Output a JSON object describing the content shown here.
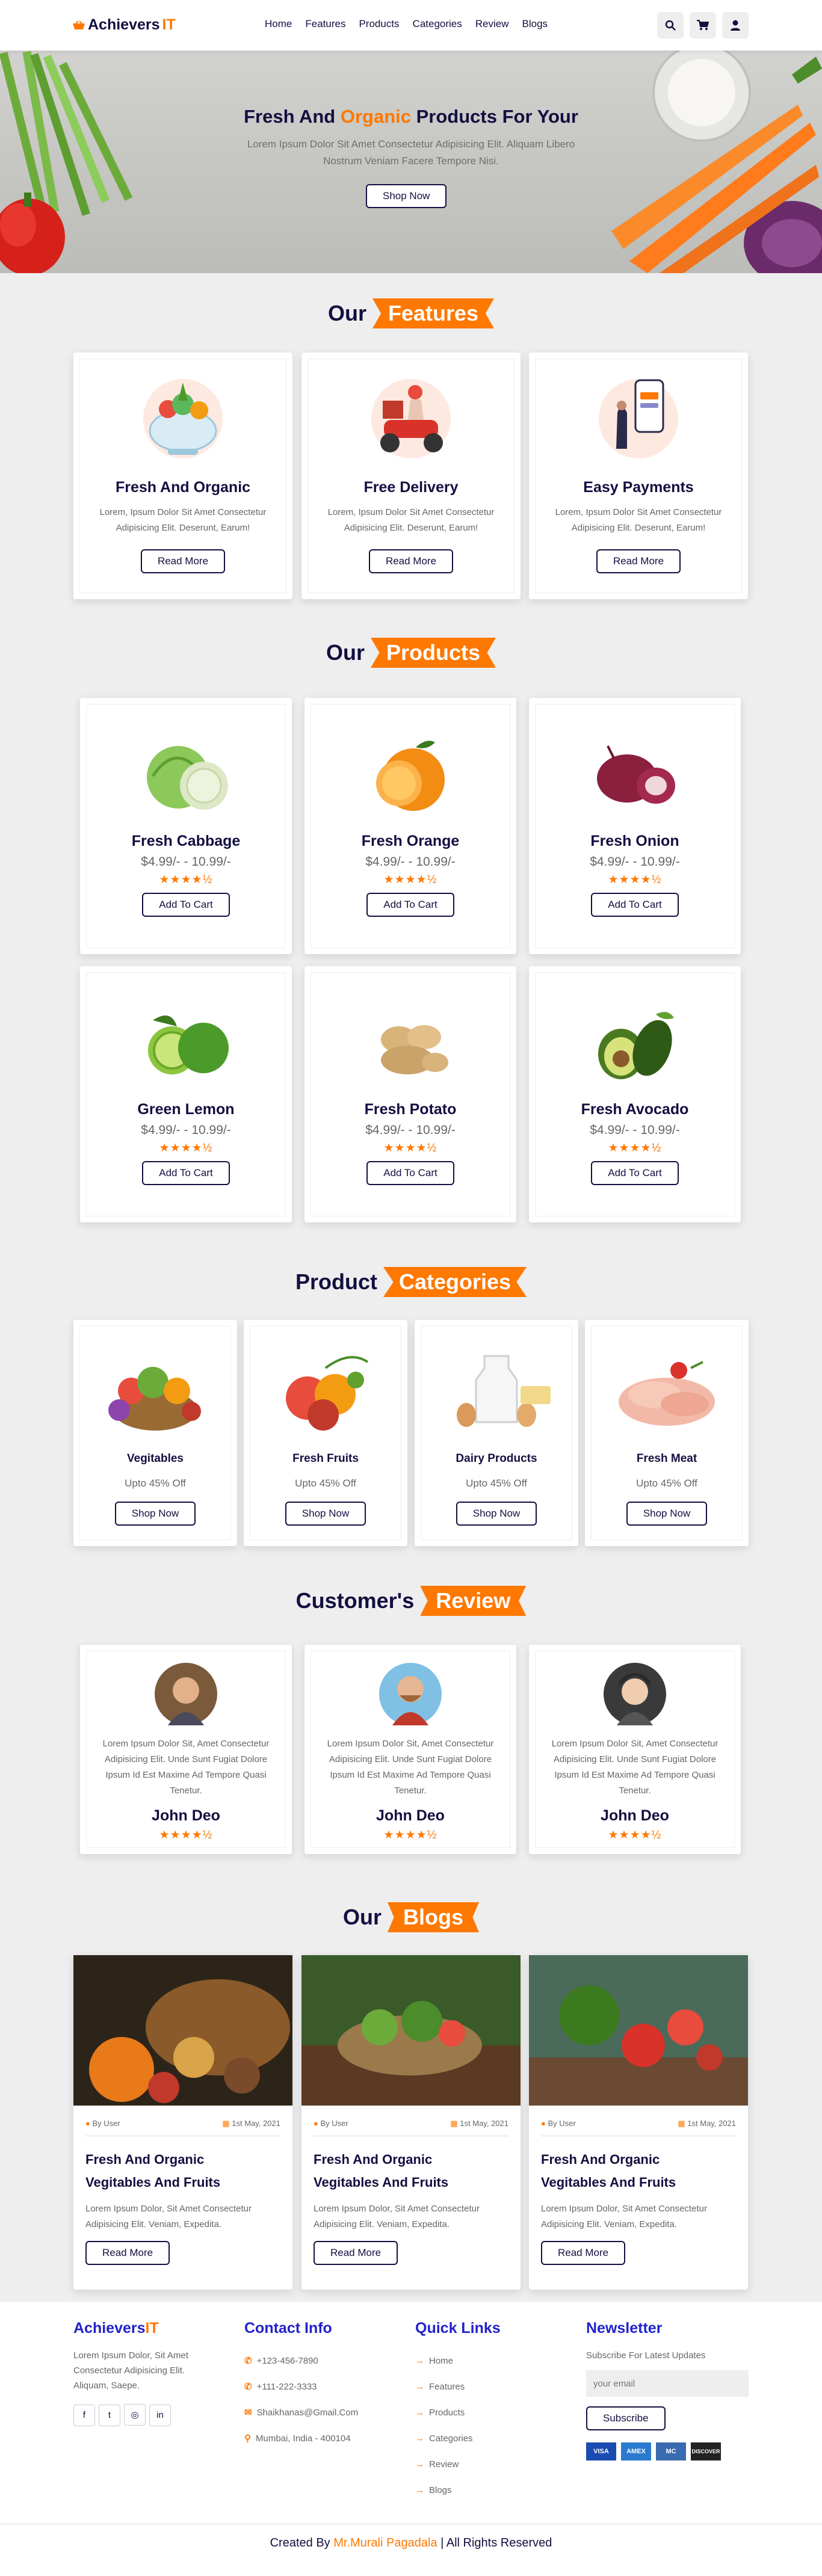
{
  "brand": {
    "name": "Achievers",
    "suffix": "IT"
  },
  "nav": [
    "Home",
    "Features",
    "Products",
    "Categories",
    "Review",
    "Blogs"
  ],
  "icons": [
    "search-icon",
    "cart-icon",
    "user-icon"
  ],
  "hero": {
    "title_pre": "Fresh And ",
    "title_accent": "Organic",
    "title_post": " Products For Your",
    "text": "Lorem Ipsum Dolor Sit Amet Consectetur Adipisicing Elit. Aliquam Libero Nostrum Veniam Facere Tempore Nisi.",
    "button": "Shop Now"
  },
  "features": {
    "heading": "Our",
    "ribbon": "Features",
    "items": [
      {
        "title": "Fresh And Organic",
        "text": "Lorem, Ipsum Dolor Sit Amet Consectetur Adipisicing Elit. Deserunt, Earum!",
        "button": "Read More"
      },
      {
        "title": "Free Delivery",
        "text": "Lorem, Ipsum Dolor Sit Amet Consectetur Adipisicing Elit. Deserunt, Earum!",
        "button": "Read More"
      },
      {
        "title": "Easy Payments",
        "text": "Lorem, Ipsum Dolor Sit Amet Consectetur Adipisicing Elit. Deserunt, Earum!",
        "button": "Read More"
      }
    ]
  },
  "products": {
    "heading": "Our",
    "ribbon": "Products",
    "items": [
      {
        "name": "Fresh Cabbage",
        "price": "$4.99/- - 10.99/-",
        "stars": "★★★★½",
        "button": "Add To Cart"
      },
      {
        "name": "Fresh Orange",
        "price": "$4.99/- - 10.99/-",
        "stars": "★★★★½",
        "button": "Add To Cart"
      },
      {
        "name": "Fresh Onion",
        "price": "$4.99/- - 10.99/-",
        "stars": "★★★★½",
        "button": "Add To Cart"
      },
      {
        "name": "Green Lemon",
        "price": "$4.99/- - 10.99/-",
        "stars": "★★★★½",
        "button": "Add To Cart"
      },
      {
        "name": "Fresh Potato",
        "price": "$4.99/- - 10.99/-",
        "stars": "★★★★½",
        "button": "Add To Cart"
      },
      {
        "name": "Fresh Avocado",
        "price": "$4.99/- - 10.99/-",
        "stars": "★★★★½",
        "button": "Add To Cart"
      }
    ]
  },
  "categories": {
    "heading": "Product",
    "ribbon": "Categories",
    "items": [
      {
        "name": "Vegitables",
        "offer": "Upto 45% Off",
        "button": "Shop Now"
      },
      {
        "name": "Fresh Fruits",
        "offer": "Upto 45% Off",
        "button": "Shop Now"
      },
      {
        "name": "Dairy Products",
        "offer": "Upto 45% Off",
        "button": "Shop Now"
      },
      {
        "name": "Fresh Meat",
        "offer": "Upto 45% Off",
        "button": "Shop Now"
      }
    ]
  },
  "reviews": {
    "heading": "Customer's",
    "ribbon": "Review",
    "items": [
      {
        "text": "Lorem Ipsum Dolor Sit, Amet Consectetur Adipisicing Elit. Unde Sunt Fugiat Dolore Ipsum Id Est Maxime Ad Tempore Quasi Tenetur.",
        "name": "John Deo",
        "stars": "★★★★½"
      },
      {
        "text": "Lorem Ipsum Dolor Sit, Amet Consectetur Adipisicing Elit. Unde Sunt Fugiat Dolore Ipsum Id Est Maxime Ad Tempore Quasi Tenetur.",
        "name": "John Deo",
        "stars": "★★★★½"
      },
      {
        "text": "Lorem Ipsum Dolor Sit, Amet Consectetur Adipisicing Elit. Unde Sunt Fugiat Dolore Ipsum Id Est Maxime Ad Tempore Quasi Tenetur.",
        "name": "John Deo",
        "stars": "★★★★½"
      }
    ]
  },
  "blogs": {
    "heading": "Our",
    "ribbon": "Blogs",
    "items": [
      {
        "user": "By User",
        "date": "1st May, 2021",
        "title_line1": "Fresh And Organic",
        "title_line2": "Vegitables And Fruits",
        "text": "Lorem Ipsum Dolor, Sit Amet Consectetur Adipisicing Elit. Veniam, Expedita.",
        "button": "Read More"
      },
      {
        "user": "By User",
        "date": "1st May, 2021",
        "title_line1": "Fresh And Organic",
        "title_line2": "Vegitables And Fruits",
        "text": "Lorem Ipsum Dolor, Sit Amet Consectetur Adipisicing Elit. Veniam, Expedita.",
        "button": "Read More"
      },
      {
        "user": "By User",
        "date": "1st May, 2021",
        "title_line1": "Fresh And Organic",
        "title_line2": "Vegitables And Fruits",
        "text": "Lorem Ipsum Dolor, Sit Amet Consectetur Adipisicing Elit. Veniam, Expedita.",
        "button": "Read More"
      }
    ]
  },
  "footer": {
    "about": "Lorem Ipsum Dolor, Sit Amet Consectetur Adipisicing Elit. Aliquam, Saepe.",
    "contact_title": "Contact Info",
    "contacts": [
      "+123-456-7890",
      "+111-222-3333",
      "Shaikhanas@Gmail.Com",
      "Mumbai, India - 400104"
    ],
    "links_title": "Quick Links",
    "links": [
      "Home",
      "Features",
      "Products",
      "Categories",
      "Review",
      "Blogs"
    ],
    "newsletter_title": "Newsletter",
    "newsletter_text": "Subscribe For Latest Updates",
    "email_placeholder": "your email",
    "subscribe": "Subscribe",
    "cards": [
      "VISA",
      "AMEX",
      "MC",
      "DISCOVER"
    ],
    "credit_pre": "Created By ",
    "credit_name": "Mr.Murali Pagadala",
    "credit_post": " | All Rights Reserved"
  },
  "colors": {
    "accent": "#ff7800",
    "dark": "#130f40",
    "footer_heading": "#2222cc"
  }
}
